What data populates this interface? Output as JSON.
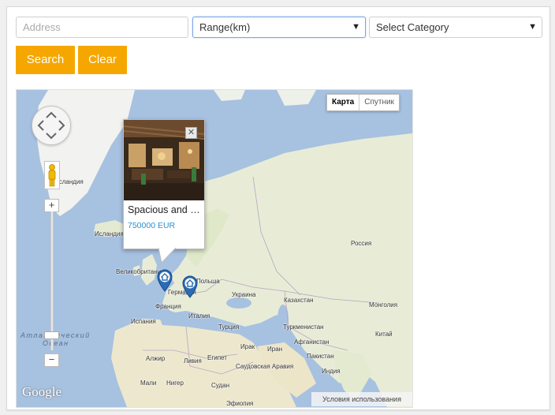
{
  "filters": {
    "address_placeholder": "Address",
    "address_value": "",
    "range_selected": "Range(km)",
    "category_selected": "Select Category",
    "dropdown_arrow": "▼"
  },
  "buttons": {
    "search_label": "Search",
    "clear_label": "Clear"
  },
  "colors": {
    "button_bg": "#f5a700",
    "price_text": "#2a90d0",
    "map_water": "#a7c1e0",
    "map_land": "#e8ecd6"
  },
  "map": {
    "type_map_label": "Карта",
    "type_satellite_label": "Спутник",
    "terms_label": "Условия использования",
    "logo_text": "Google",
    "zoom_in_label": "+",
    "zoom_out_label": "−",
    "ocean_label_line1": "Атлантический",
    "ocean_label_line2": "Океан",
    "labels": [
      {
        "text": "Исландия"
      },
      {
        "text": "Исландия"
      },
      {
        "text": "Великобритания"
      },
      {
        "text": "Германия"
      },
      {
        "text": "Польша"
      },
      {
        "text": "Франция"
      },
      {
        "text": "Испания"
      },
      {
        "text": "Италия"
      },
      {
        "text": "Украина"
      },
      {
        "text": "Россия"
      },
      {
        "text": "Казахстан"
      },
      {
        "text": "Монголия"
      },
      {
        "text": "Турция"
      },
      {
        "text": "Туркменистан"
      },
      {
        "text": "Ирак"
      },
      {
        "text": "Иран"
      },
      {
        "text": "Афганистан"
      },
      {
        "text": "Китай"
      },
      {
        "text": "Египет"
      },
      {
        "text": "Саудовская Аравия"
      },
      {
        "text": "Пакистан"
      },
      {
        "text": "Индия"
      },
      {
        "text": "Алжир"
      },
      {
        "text": "Ливия"
      },
      {
        "text": "Мали"
      },
      {
        "text": "Нигер"
      },
      {
        "text": "Судан"
      },
      {
        "text": "Эфиопия"
      }
    ],
    "markers": [
      {
        "name": "property-marker-1",
        "icon": "home-pin-icon"
      },
      {
        "name": "property-marker-2",
        "icon": "home-pin-icon"
      }
    ]
  },
  "popup": {
    "title": "Spacious and Luxurious Villa",
    "price": "750000 EUR",
    "close_label": "✕"
  }
}
